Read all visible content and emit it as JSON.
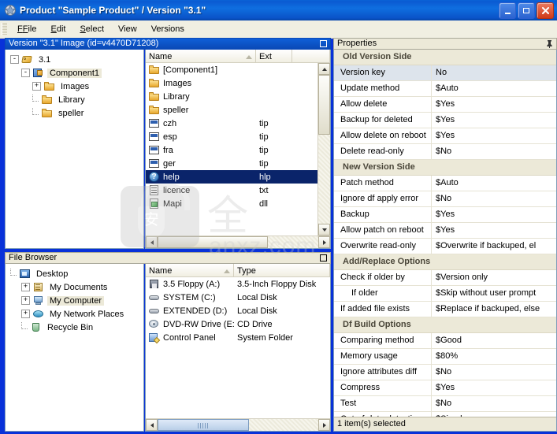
{
  "window": {
    "title": "Product \"Sample Product\" / Version \"3.1\"",
    "icon": "app-icon",
    "minimize_label": "_",
    "maximize_label": "□",
    "close_label": "✕"
  },
  "menubar": {
    "items": [
      {
        "label": "File"
      },
      {
        "label": "Edit"
      },
      {
        "label": "Select"
      },
      {
        "label": "View"
      },
      {
        "label": "Versions"
      }
    ]
  },
  "version_panel": {
    "caption": "Version \"3.1\" Image (id=v4470D71208)",
    "tree": [
      {
        "label": "3.1",
        "icon": "tag-icon",
        "expander": "-",
        "depth": 0,
        "state": "normal"
      },
      {
        "label": "Component1",
        "icon": "component-icon",
        "expander": "-",
        "depth": 1,
        "state": "selected-inactive"
      },
      {
        "label": "Images",
        "icon": "folder-icon",
        "expander": "+",
        "depth": 2,
        "state": "normal"
      },
      {
        "label": "Library",
        "icon": "folder-icon",
        "expander": "",
        "depth": 2,
        "state": "normal"
      },
      {
        "label": "speller",
        "icon": "folder-icon",
        "expander": "",
        "depth": 2,
        "state": "normal"
      }
    ]
  },
  "file_list": {
    "columns": [
      {
        "label": "Name",
        "sort": "asc"
      },
      {
        "label": "Ext",
        "sort": ""
      }
    ],
    "rows": [
      {
        "name": "[Component1]",
        "ext": "",
        "icon": "folder-icon",
        "selected": false
      },
      {
        "name": "Images",
        "ext": "",
        "icon": "folder-icon",
        "selected": false
      },
      {
        "name": "Library",
        "ext": "",
        "icon": "folder-icon",
        "selected": false
      },
      {
        "name": "speller",
        "ext": "",
        "icon": "folder-icon",
        "selected": false
      },
      {
        "name": "czh",
        "ext": "tip",
        "icon": "tip-file-icon",
        "selected": false
      },
      {
        "name": "esp",
        "ext": "tip",
        "icon": "tip-file-icon",
        "selected": false
      },
      {
        "name": "fra",
        "ext": "tip",
        "icon": "tip-file-icon",
        "selected": false
      },
      {
        "name": "ger",
        "ext": "tip",
        "icon": "tip-file-icon",
        "selected": false
      },
      {
        "name": "help",
        "ext": "hlp",
        "icon": "help-file-icon",
        "selected": true
      },
      {
        "name": "licence",
        "ext": "txt",
        "icon": "text-file-icon",
        "selected": false
      },
      {
        "name": "Mapi",
        "ext": "dll",
        "icon": "dll-file-icon",
        "selected": false
      }
    ]
  },
  "file_browser": {
    "caption": "File Browser",
    "tree": [
      {
        "label": "Desktop",
        "icon": "desktop-icon",
        "expander": "",
        "depth": 0,
        "state": "normal"
      },
      {
        "label": "My Documents",
        "icon": "my-documents-icon",
        "expander": "+",
        "depth": 1,
        "state": "normal"
      },
      {
        "label": "My Computer",
        "icon": "my-computer-icon",
        "expander": "+",
        "depth": 1,
        "state": "selected-inactive"
      },
      {
        "label": "My Network Places",
        "icon": "network-places-icon",
        "expander": "+",
        "depth": 1,
        "state": "normal"
      },
      {
        "label": "Recycle Bin",
        "icon": "recycle-bin-icon",
        "expander": "",
        "depth": 1,
        "state": "normal"
      }
    ],
    "columns": [
      {
        "label": "Name",
        "sort": "asc"
      },
      {
        "label": "Type",
        "sort": ""
      }
    ],
    "rows": [
      {
        "name": "3.5 Floppy (A:)",
        "type": "3.5-Inch Floppy Disk",
        "icon": "floppy-icon"
      },
      {
        "name": "SYSTEM (C:)",
        "type": "Local Disk",
        "icon": "hard-disk-icon"
      },
      {
        "name": "EXTENDED (D:)",
        "type": "Local Disk",
        "icon": "hard-disk-icon"
      },
      {
        "name": "DVD-RW Drive (E:)",
        "type": "CD Drive",
        "icon": "cd-drive-icon"
      },
      {
        "name": "Control Panel",
        "type": "System Folder",
        "icon": "control-panel-icon"
      }
    ]
  },
  "properties": {
    "caption": "Properties",
    "pin_label": "⚐",
    "status": "1 item(s) selected",
    "rows": [
      {
        "type": "category",
        "name": "Old Version Side",
        "value": ""
      },
      {
        "type": "prop",
        "name": "Version key",
        "value": "No",
        "selected": true
      },
      {
        "type": "prop",
        "name": "Update method",
        "value": "$Auto"
      },
      {
        "type": "prop",
        "name": "Allow delete",
        "value": "$Yes"
      },
      {
        "type": "prop",
        "name": "Backup for deleted",
        "value": "$Yes"
      },
      {
        "type": "prop",
        "name": "Allow delete on reboot",
        "value": "$Yes"
      },
      {
        "type": "prop",
        "name": "Delete read-only",
        "value": "$No"
      },
      {
        "type": "category",
        "name": "New Version Side",
        "value": ""
      },
      {
        "type": "prop",
        "name": "Patch method",
        "value": "$Auto"
      },
      {
        "type": "prop",
        "name": "Ignore df apply error",
        "value": "$No"
      },
      {
        "type": "prop",
        "name": "Backup",
        "value": "$Yes"
      },
      {
        "type": "prop",
        "name": "Allow patch on reboot",
        "value": "$Yes"
      },
      {
        "type": "prop",
        "name": "Overwrite read-only",
        "value": "$Overwrite if backuped, el"
      },
      {
        "type": "category",
        "name": "Add/Replace Options",
        "value": ""
      },
      {
        "type": "prop",
        "name": "Check if older by",
        "value": "$Version only"
      },
      {
        "type": "prop",
        "name": "If older",
        "value": "$Skip without user prompt",
        "indent": true
      },
      {
        "type": "prop",
        "name": "If added file exists",
        "value": "$Replace if backuped, else"
      },
      {
        "type": "category",
        "name": "Df Build Options",
        "value": ""
      },
      {
        "type": "prop",
        "name": "Comparing method",
        "value": "$Good"
      },
      {
        "type": "prop",
        "name": "Memory usage",
        "value": "$80%"
      },
      {
        "type": "prop",
        "name": "Ignore attributes diff",
        "value": "$No"
      },
      {
        "type": "prop",
        "name": "Compress",
        "value": "$Yes"
      },
      {
        "type": "prop",
        "name": "Test",
        "value": "$No"
      },
      {
        "type": "prop",
        "name": "Out-of-date detection",
        "value": "$Simple"
      }
    ]
  },
  "watermark": {
    "text": "安",
    "brand": "anxz.com"
  },
  "colors": {
    "titlebar": "#0a5ad2",
    "selection": "#0a246a",
    "panel_bg": "#ece9d8",
    "accent": "#316ac5"
  }
}
